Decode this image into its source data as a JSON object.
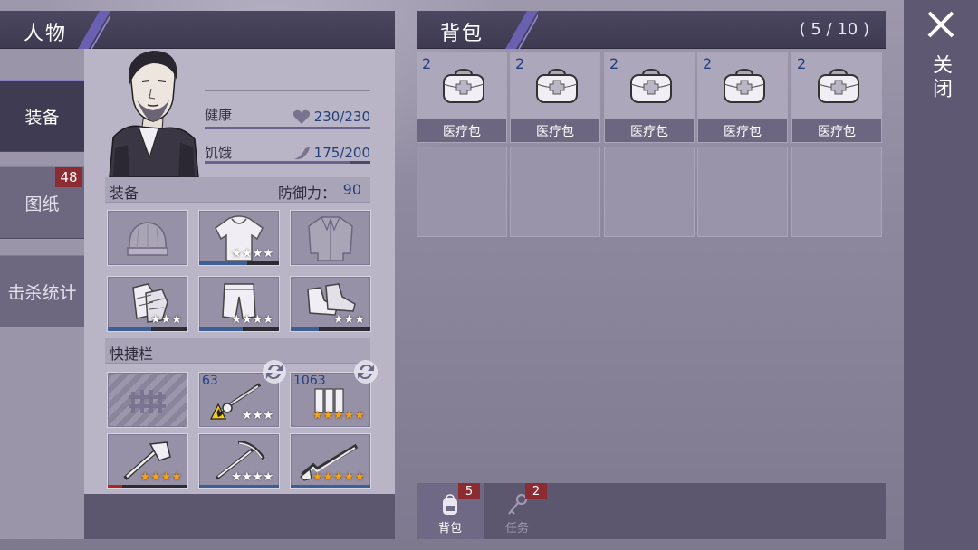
{
  "character_panel": {
    "title": "人物",
    "tabs": [
      {
        "label": "装备",
        "active": true
      },
      {
        "label": "图纸",
        "badge": "48"
      },
      {
        "label": "击杀统计"
      }
    ],
    "stats": {
      "health": {
        "label": "健康",
        "value": "230/230",
        "fraction": 1.0,
        "icon": "heart-icon"
      },
      "hunger": {
        "label": "饥饿",
        "value": "175/200",
        "fraction": 0.875,
        "icon": "hunger-icon"
      }
    },
    "equipment": {
      "label": "装备",
      "defense_label": "防御力：",
      "defense_value": "90",
      "slots": [
        {
          "name": "hat",
          "icon": "beanie-icon",
          "stars": "",
          "durability": 0
        },
        {
          "name": "shirt",
          "icon": "hoodie-icon",
          "stars": "★★★★",
          "durability": 0.6
        },
        {
          "name": "jacket",
          "icon": "jacket-icon",
          "stars": "",
          "durability": 0
        },
        {
          "name": "gloves",
          "icon": "gloves-icon",
          "stars": "★★★",
          "durability": 0.55
        },
        {
          "name": "pants",
          "icon": "pants-icon",
          "stars": "★★★★",
          "durability": 0.55
        },
        {
          "name": "shoes",
          "icon": "shoes-icon",
          "stars": "★★★",
          "durability": 0.35
        }
      ]
    },
    "quickbar": {
      "label": "快捷栏",
      "slots": [
        {
          "name": "locked-slot",
          "icon": "locked-fence-icon",
          "locked": true
        },
        {
          "name": "flamethrower",
          "icon": "flamethrower-icon",
          "count": "63",
          "stars": "★★★",
          "gold": false,
          "durability": 0,
          "swap": true
        },
        {
          "name": "ammo",
          "icon": "ammo-icon",
          "count": "1063",
          "stars": "★★★★★",
          "gold": true,
          "durability": 0,
          "swap": true
        },
        {
          "name": "axe",
          "icon": "axe-icon",
          "stars": "★★★★",
          "gold": true,
          "durability": 0.18,
          "durability_color": "red"
        },
        {
          "name": "pickaxe",
          "icon": "pickaxe-icon",
          "stars": "★★★★",
          "gold": false,
          "durability": 1.0
        },
        {
          "name": "shotgun",
          "icon": "shotgun-icon",
          "stars": "★★★★★",
          "gold": true,
          "durability": 1.0
        }
      ]
    }
  },
  "backpack_panel": {
    "title": "背包",
    "capacity": "( 5 / 10 )",
    "items": [
      {
        "name": "医疗包",
        "count": "2",
        "icon": "medkit-icon"
      },
      {
        "name": "医疗包",
        "count": "2",
        "icon": "medkit-icon"
      },
      {
        "name": "医疗包",
        "count": "2",
        "icon": "medkit-icon"
      },
      {
        "name": "医疗包",
        "count": "2",
        "icon": "medkit-icon"
      },
      {
        "name": "医疗包",
        "count": "2",
        "icon": "medkit-icon"
      }
    ],
    "tabs": [
      {
        "label": "背包",
        "badge": "5",
        "icon": "backpack-icon",
        "active": true
      },
      {
        "label": "任务",
        "badge": "2",
        "icon": "key-icon",
        "active": false
      }
    ]
  },
  "close": {
    "label": "关闭",
    "icon": "close-icon"
  },
  "colors": {
    "accent_purple": "#6a5fb0",
    "badge_red": "#8c2b31",
    "value_blue": "#23407a",
    "star_gold": "#f4a21d"
  }
}
